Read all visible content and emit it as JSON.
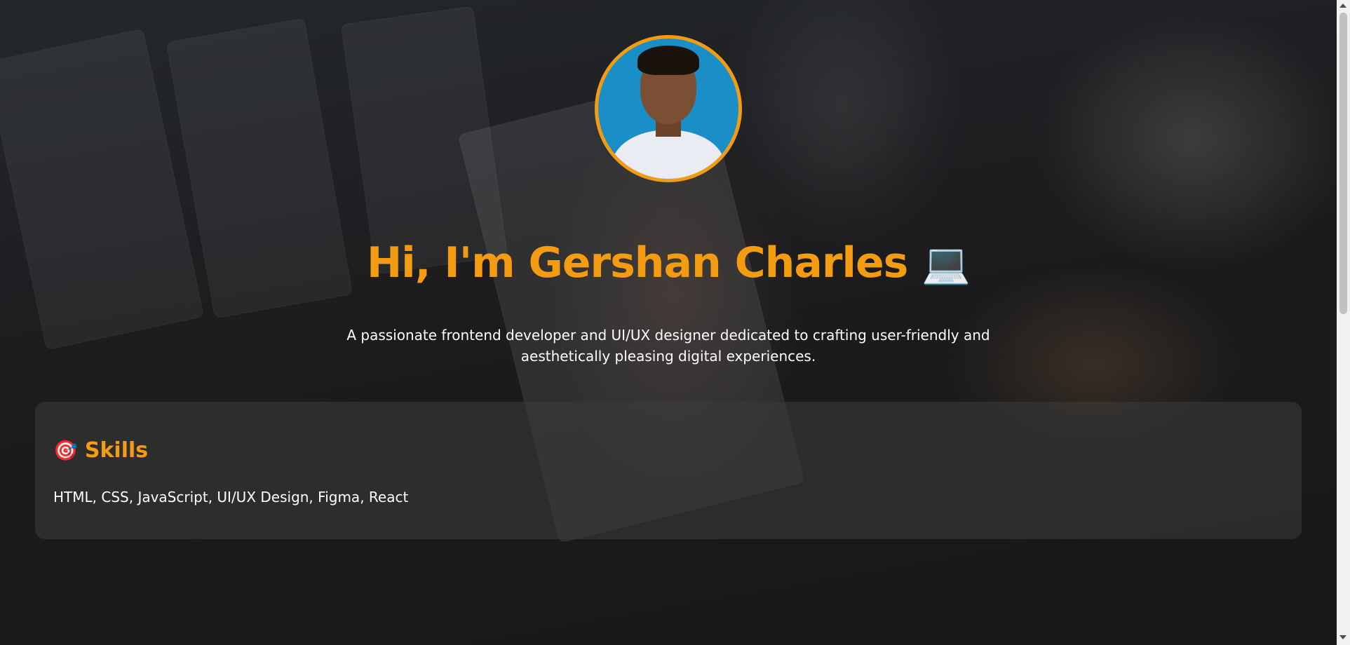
{
  "hero": {
    "title": "Hi, I'm Gershan Charles",
    "title_icon": "💻",
    "subtitle_line1": "A passionate frontend developer and UI/UX designer dedicated to crafting user-friendly and",
    "subtitle_line2": "aesthetically pleasing digital experiences.",
    "accent_color": "#f39c12"
  },
  "skills": {
    "icon": "🎯",
    "heading": "Skills",
    "list": "HTML, CSS, JavaScript, UI/UX Design, Figma, React"
  }
}
